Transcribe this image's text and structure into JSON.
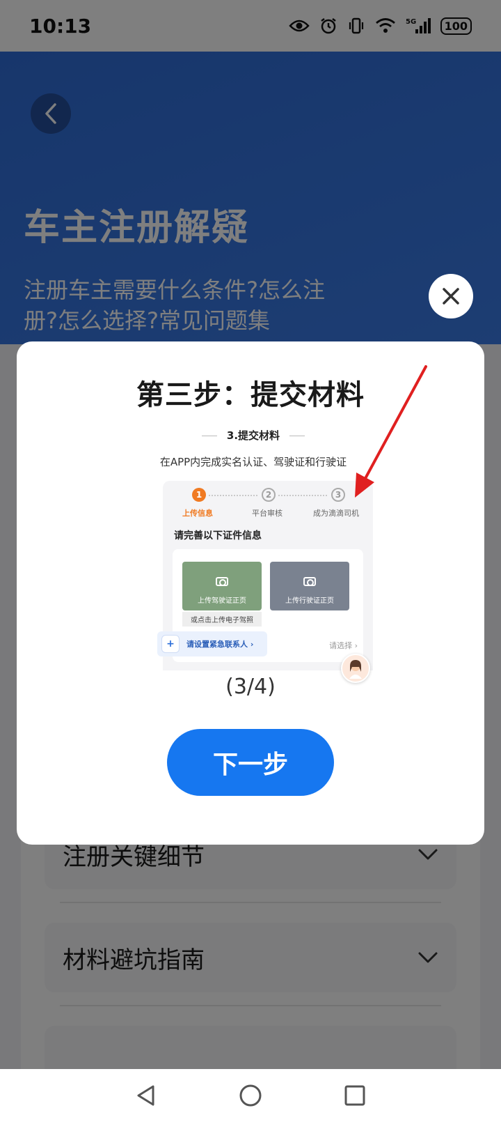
{
  "status_bar": {
    "time": "10:13",
    "battery": "100",
    "network": "5G"
  },
  "page": {
    "title": "车主注册解疑",
    "subtitle": "注册车主需要什么条件?怎么注册?怎么选择?常见问题集",
    "accordion": [
      {
        "label": "注册关键细节"
      },
      {
        "label": "材料避坑指南"
      }
    ]
  },
  "modal": {
    "title": "第三步：提交材料",
    "illustration": {
      "step_heading": "3.提交材料",
      "description": "在APP内完成实名认证、驾驶证和行驶证",
      "steps": [
        {
          "num": "1",
          "label": "上传信息",
          "active": true
        },
        {
          "num": "2",
          "label": "平台审核",
          "active": false
        },
        {
          "num": "3",
          "label": "成为滴滴司机",
          "active": false
        }
      ],
      "section_heading": "请完善以下证件信息",
      "driver_license_label": "上传驾驶证正页",
      "vehicle_license_label": "上传行驶证正页",
      "electronic_license_link": "或点击上传电子驾照",
      "emergency_contact_label": "请设置紧急联系人 ›",
      "select_hint": "请选择 ›"
    },
    "page_indicator": "(3/4)",
    "next_button": "下一步"
  },
  "colors": {
    "primary": "#1677f0",
    "hero": "#2f6dd8",
    "active_step": "#f07a22"
  }
}
